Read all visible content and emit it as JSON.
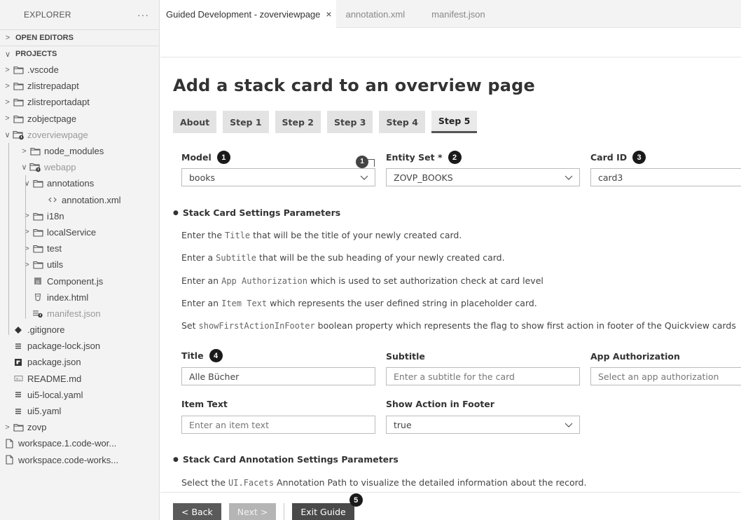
{
  "sidebar": {
    "header": "EXPLORER",
    "more": "···",
    "open_editors": "OPEN EDITORS",
    "projects": "PROJECTS",
    "items": [
      {
        "label": ".vscode"
      },
      {
        "label": "zlistrepadapt"
      },
      {
        "label": "zlistreportadapt"
      },
      {
        "label": "zobjectpage"
      },
      {
        "label": "zoverviewpage"
      },
      {
        "label": "node_modules"
      },
      {
        "label": "webapp"
      },
      {
        "label": "annotations"
      },
      {
        "label": "annotation.xml"
      },
      {
        "label": "i18n"
      },
      {
        "label": "localService"
      },
      {
        "label": "test"
      },
      {
        "label": "utils"
      },
      {
        "label": "Component.js"
      },
      {
        "label": "index.html"
      },
      {
        "label": "manifest.json"
      },
      {
        "label": ".gitignore"
      },
      {
        "label": "package-lock.json"
      },
      {
        "label": "package.json"
      },
      {
        "label": "README.md"
      },
      {
        "label": "ui5-local.yaml"
      },
      {
        "label": "ui5.yaml"
      },
      {
        "label": "zovp"
      },
      {
        "label": "workspace.1.code-wor..."
      },
      {
        "label": "workspace.code-works..."
      }
    ]
  },
  "tabs": [
    {
      "label": "Guided Development - zoverviewpage",
      "close": "×"
    },
    {
      "label": "annotation.xml"
    },
    {
      "label": "manifest.json"
    }
  ],
  "main": {
    "title": "Add a stack card to an overview page",
    "steps": [
      "About",
      "Step 1",
      "Step 2",
      "Step 3",
      "Step 4",
      "Step 5"
    ],
    "active_step": "Step 5",
    "model": {
      "label": "Model",
      "badge": "1",
      "value": "books"
    },
    "warning_badge": "1",
    "entity_set": {
      "label": "Entity Set *",
      "badge": "2",
      "value": "ZOVP_BOOKS"
    },
    "card_id": {
      "label": "Card ID",
      "badge": "3",
      "value": "card3"
    },
    "settings_heading": "Stack Card Settings Parameters",
    "instructions": [
      {
        "pre": "Enter the ",
        "code": "Title",
        "post": " that will be the title of your newly created card."
      },
      {
        "pre": "Enter a ",
        "code": "Subtitle",
        "post": " that will be the sub heading of your newly created card."
      },
      {
        "pre": "Enter an ",
        "code": "App Authorization",
        "post": " which is used to set authorization check at card level"
      },
      {
        "pre": "Enter an ",
        "code": "Item Text",
        "post": " which represents the user defined string in placeholder card."
      },
      {
        "pre": "Set ",
        "code": "showFirstActionInFooter",
        "post": " boolean property which represents the flag to show first action in footer of the Quickview cards"
      }
    ],
    "title_field": {
      "label": "Title",
      "badge": "4",
      "value": "Alle Bücher"
    },
    "subtitle_field": {
      "label": "Subtitle",
      "placeholder": "Enter a subtitle for the card"
    },
    "app_auth_field": {
      "label": "App Authorization",
      "placeholder": "Select an app authorization"
    },
    "item_text_field": {
      "label": "Item Text",
      "placeholder": "Enter an item text"
    },
    "show_action_field": {
      "label": "Show Action in Footer",
      "value": "true"
    },
    "annotation_heading": "Stack Card Annotation Settings Parameters",
    "annotation_line": {
      "pre": "Select the ",
      "code": "UI.Facets",
      "post": " Annotation Path to visualize the detailed information about the record."
    },
    "buttons": {
      "back": "< Back",
      "next": "Next >",
      "exit": "Exit Guide",
      "exit_badge": "5"
    }
  }
}
